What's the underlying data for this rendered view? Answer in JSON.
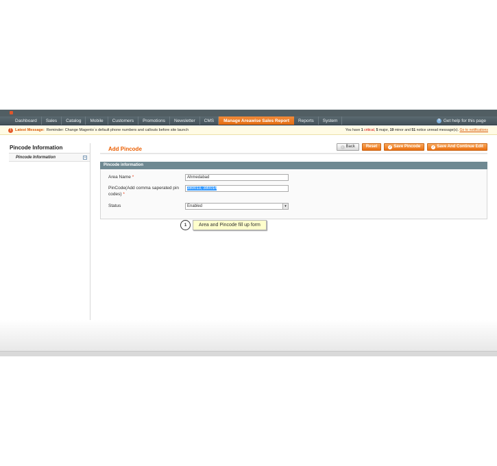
{
  "nav": {
    "items": [
      "Dashboard",
      "Sales",
      "Catalog",
      "Mobile",
      "Customers",
      "Promotions",
      "Newsletter",
      "CMS",
      "Manage Areawise Sales Report",
      "Reports",
      "System"
    ],
    "active_index": 8,
    "help": "Get help for this page"
  },
  "notice": {
    "latest": "Latest Message:",
    "text": "Reminder: Change Magento`s default phone numbers and callouts before site launch",
    "summary_prefix": "You have",
    "critical_count": "1",
    "critical_label": "critical,",
    "major_count": "5",
    "major_label": "major,",
    "minor_count": "19",
    "minor_label": "minor and",
    "notice_count": "51",
    "notice_label": "notice unread message(s).",
    "link": "Go to notifications"
  },
  "sidebar": {
    "title": "Pincode Information",
    "tab": "Pincode Information"
  },
  "page": {
    "title": "Add Pincode",
    "buttons": {
      "back": "Back",
      "reset": "Reset",
      "save": "Save Pincode",
      "save_continue": "Save And Continue Edit"
    }
  },
  "form": {
    "section_title": "Pincode information",
    "area_label": "Area Name",
    "area_value": "Ahmedabad",
    "pincode_label": "PinCode(Add comma saperated pin codes)",
    "pincode_value": "380013, 380014",
    "status_label": "Status",
    "status_value": "Enabled",
    "required_mark": "*"
  },
  "callout": {
    "number": "1",
    "text": "Area and Pincode fill up form"
  },
  "colors": {
    "accent": "#eb5e00",
    "nav_bg": "#515e63",
    "section_header": "#6f8992"
  }
}
